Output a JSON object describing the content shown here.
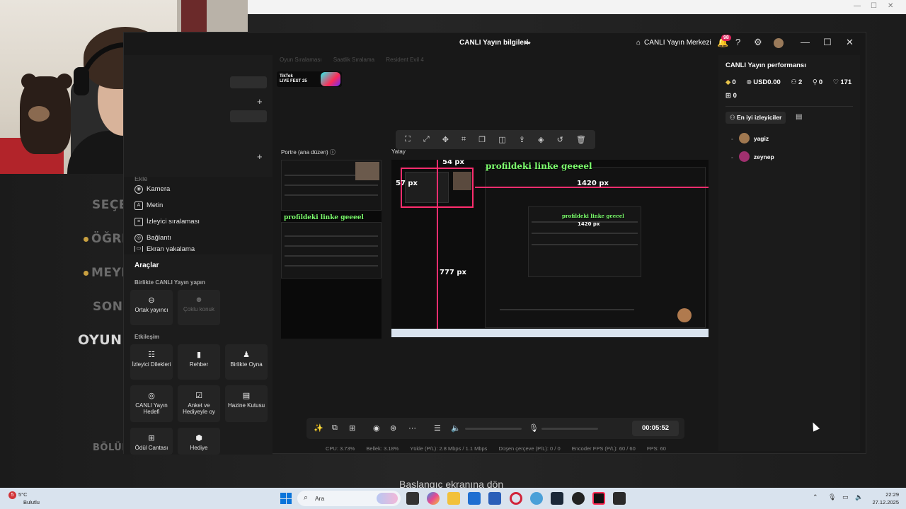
{
  "background": {
    "menu_items": [
      "SEÇEN",
      "ÖĞRET",
      "MEYD",
      "SONU",
      "OYUNDA",
      "BÖLÜM"
    ],
    "subtitle": "Başlangıç ekranına dön"
  },
  "window": {
    "title": "CANLI Yayın bilgileri",
    "live_center": "CANLI Yayın Merkezi",
    "notification_count": "98"
  },
  "source_tabs": [
    "Oyun Sıralaması",
    "Saatlik Sıralama",
    "Resident Evil 4"
  ],
  "banner": {
    "line1": "TikTok",
    "line2": "LIVE FEST 25"
  },
  "left_panel": {
    "partial_header": "Ekle",
    "items": [
      {
        "label": "Kamera",
        "icon": "camera-icon",
        "glyph": "◉"
      },
      {
        "label": "Metin",
        "icon": "text-icon",
        "glyph": "A"
      },
      {
        "label": "İzleyici sıralaması",
        "icon": "ranking-icon",
        "glyph": "≡"
      },
      {
        "label": "Bağlantı",
        "icon": "globe-icon",
        "glyph": "◎"
      },
      {
        "label": "Ekran yakalama",
        "icon": "screen-capture-icon",
        "glyph": "▭"
      }
    ]
  },
  "tools": {
    "title": "Araçlar",
    "section_collab": "Birlikte CANLI Yayın yapın",
    "collab_tiles": [
      {
        "label": "Ortak yayıncı",
        "icon": "link-icon",
        "glyph": "⊖",
        "enabled": true
      },
      {
        "label": "Çoklu konuk",
        "icon": "multi-guest-icon",
        "glyph": "☻",
        "enabled": false
      }
    ],
    "section_engage": "Etkileşim",
    "engage_tiles": [
      {
        "label": "İzleyici Dilekleri",
        "icon": "viewer-wishes-icon",
        "glyph": "☷"
      },
      {
        "label": "Rehber",
        "icon": "guide-icon",
        "glyph": "▮"
      },
      {
        "label": "Birlikte Oyna",
        "icon": "play-together-icon",
        "glyph": "♟"
      },
      {
        "label": "CANLI Yayın Hedefi",
        "icon": "goal-icon",
        "glyph": "◎"
      },
      {
        "label": "Anket ve Hediyeyle oy",
        "icon": "poll-icon",
        "glyph": "☑"
      },
      {
        "label": "Hazine Kutusu",
        "icon": "treasure-box-icon",
        "glyph": "▤"
      },
      {
        "label": "Ödül Cantası",
        "icon": "reward-bag-icon",
        "glyph": "⊞"
      },
      {
        "label": "Hediye",
        "icon": "gift-icon",
        "glyph": "⬢"
      }
    ]
  },
  "preview": {
    "portrait_label": "Portre (ana düzen)",
    "landscape_label": "Yatay",
    "overlay_text": "profildeki linke geeeel",
    "measure_top": "54 px",
    "measure_left": "57 px",
    "measure_right": "1420 px",
    "measure_bottom": "777 px",
    "inner_overlay_text": "profildeki linke geeeel",
    "inner_measure": "1420 px"
  },
  "float_toolbar": {
    "icons": [
      "fullscreen-icon",
      "expand-icon",
      "center-icon",
      "crop-icon",
      "duplicate-icon",
      "flip-icon",
      "bring-front-icon",
      "layers-icon",
      "rotate-icon",
      "delete-icon"
    ],
    "glyphs": [
      "⛶",
      "⤢",
      "✥",
      "⌗",
      "❐",
      "◫",
      "⇪",
      "◈",
      "↺",
      "🗑"
    ]
  },
  "controls": {
    "timer": "00:05:52"
  },
  "stats": {
    "cpu": "CPU: 3.73%",
    "memory": "Bellek: 3.18%",
    "upload": "Yükle (P/L): 2.8 Mbps / 1.1 Mbps",
    "dropped": "Düşen çerçeve (P/L): 0 / 0",
    "encoder": "Encoder FPS (P/L): 60 / 60",
    "fps": "FPS: 60"
  },
  "performance": {
    "title": "CANLI Yayın performansı",
    "diamonds": "0",
    "earnings": "USD0.00",
    "viewers": "2",
    "new_followers": "0",
    "likes": "171",
    "gifts": "0",
    "top_viewers_tab": "En iyi izleyiciler",
    "top_viewers": [
      {
        "name": "yagiz",
        "color": "#a07850"
      },
      {
        "name": "zeynep",
        "color": "#a0306e"
      }
    ]
  },
  "taskbar": {
    "weather_badge": "5",
    "temperature": "5°C",
    "condition": "Bulutlu",
    "search_placeholder": "Ara",
    "time": "22:29",
    "date": "27.12.2025"
  }
}
